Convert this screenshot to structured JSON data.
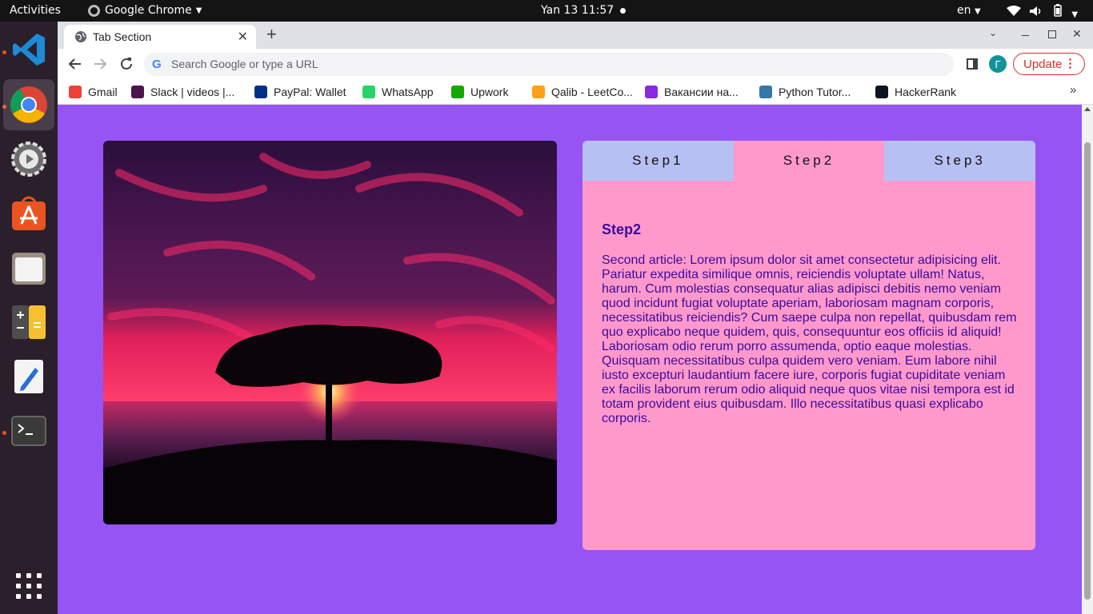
{
  "topbar": {
    "activities": "Activities",
    "app_name": "Google Chrome",
    "clock": "Yan 13  11:57",
    "lang": "en"
  },
  "dock": {
    "items": [
      "visual-studio-code",
      "google-chrome",
      "settings",
      "ubuntu-software",
      "files",
      "calculator",
      "text-editor",
      "terminal"
    ]
  },
  "browser": {
    "tab_title": "Tab Section",
    "omnibox_placeholder": "Search Google or type a URL",
    "profile_initial": "Г",
    "update_label": "Update",
    "bookmarks": [
      {
        "label": "Gmail",
        "icon": "gmail-icon",
        "color": "#ea4335"
      },
      {
        "label": "Slack | videos |...",
        "icon": "slack-icon",
        "color": "#4a154b"
      },
      {
        "label": "PayPal: Wallet",
        "icon": "paypal-icon",
        "color": "#003087"
      },
      {
        "label": "WhatsApp",
        "icon": "whatsapp-icon",
        "color": "#25d366"
      },
      {
        "label": "Upwork",
        "icon": "upwork-icon",
        "color": "#14a800"
      },
      {
        "label": "Qalib - LeetCo...",
        "icon": "leetcode-icon",
        "color": "#ffa116"
      },
      {
        "label": "Вакансии на...",
        "icon": "djinni-icon",
        "color": "#8a2be2"
      },
      {
        "label": "Python Tutor...",
        "icon": "python-icon",
        "color": "#3776ab"
      },
      {
        "label": "HackerRank",
        "icon": "hackerrank-icon",
        "color": "#0e141e"
      }
    ]
  },
  "page": {
    "background": "#9754f4",
    "tabs": [
      {
        "label": "Step1",
        "active": false
      },
      {
        "label": "Step2",
        "active": true
      },
      {
        "label": "Step3",
        "active": false
      }
    ],
    "inactive_tab_color": "#b7c0f2",
    "active_tab_color": "#ff99cc",
    "article_title": "Step2",
    "article_body": "Second article: Lorem ipsum dolor sit amet consectetur adipisicing elit. Pariatur expedita similique omnis, reiciendis voluptate ullam! Natus, harum. Cum molestias consequatur alias adipisci debitis nemo veniam quod incidunt fugiat voluptate aperiam, laboriosam magnam corporis, necessitatibus reiciendis? Cum saepe culpa non repellat, quibusdam rem quo explicabo neque quidem, quis, consequuntur eos officiis id aliquid! Laboriosam odio rerum porro assumenda, optio eaque molestias. Quisquam necessitatibus culpa quidem vero veniam. Eum labore nihil iusto excepturi laudantium facere iure, corporis fugiat cupiditate veniam ex facilis laborum rerum odio aliquid neque quos vitae nisi tempora est id totam provident eius quibusdam. Illo necessitatibus quasi explicabo corporis."
  }
}
